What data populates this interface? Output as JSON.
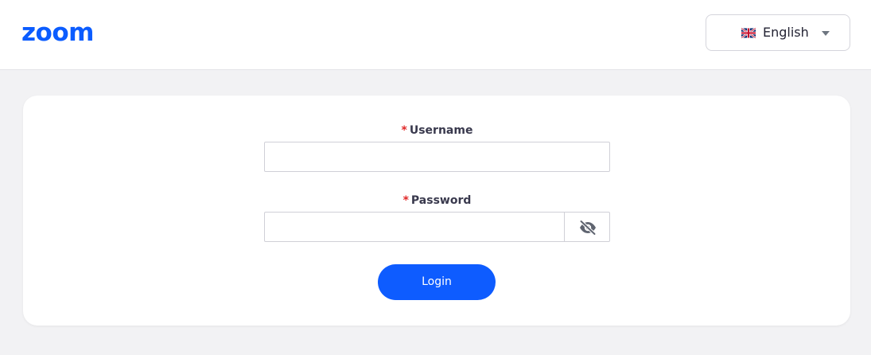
{
  "header": {
    "logo_text": "zoom",
    "language": {
      "selected": "English",
      "flag_icon": "uk-flag-icon",
      "dropdown_icon": "caret-down-icon"
    }
  },
  "login_form": {
    "username": {
      "required_marker": "*",
      "label": "Username",
      "value": "",
      "placeholder": ""
    },
    "password": {
      "required_marker": "*",
      "label": "Password",
      "value": "",
      "placeholder": "",
      "toggle_icon": "eye-slash-icon"
    },
    "login_button": "Login"
  },
  "colors": {
    "brand": "#0b5cff",
    "button": "#0e5cff",
    "required": "#e02828",
    "background": "#f2f2f4"
  }
}
